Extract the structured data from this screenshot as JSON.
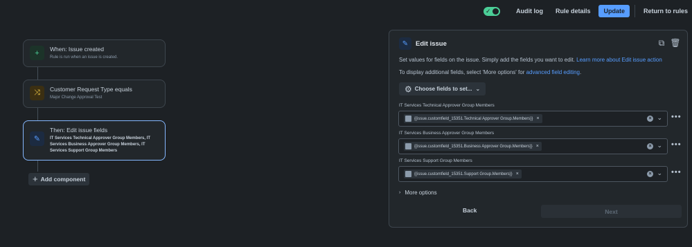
{
  "topbar": {
    "audit_log": "Audit log",
    "rule_details": "Rule details",
    "update": "Update",
    "return": "Return to rules"
  },
  "flow": {
    "trigger": {
      "title": "When: Issue created",
      "sub": "Rule is run when an issue is created."
    },
    "condition": {
      "title": "Customer Request Type equals",
      "sub": "Major Change Approval Test"
    },
    "action": {
      "title": "Then: Edit issue fields",
      "sub": "IT Services Technical Approver Group Members, IT Services Business Approver Group Members, IT Services Support Group Members"
    },
    "add_component": "Add component"
  },
  "panel": {
    "title": "Edit issue",
    "desc1_text": "Set values for fields on the issue. Simply add the fields you want to edit. ",
    "desc1_link": "Learn more about Edit issue action",
    "desc2_text": "To display additional fields, select 'More options' for ",
    "desc2_link": "advanced field editing",
    "desc2_end": ".",
    "choose": "Choose fields to set...",
    "fields": [
      {
        "label": "IT Services Technical Approver Group Members",
        "value": "{{issue.customfield_15351.Technical Approver Group.Members}}"
      },
      {
        "label": "IT Services Business Approver Group Members",
        "value": "{{issue.customfield_15351.Business Approver Group.Members}}"
      },
      {
        "label": "IT Services Support Group Members",
        "value": "{{issue.customfield_15351.Support Group.Members}}"
      }
    ],
    "more_options": "More options",
    "back": "Back",
    "next": "Next"
  }
}
